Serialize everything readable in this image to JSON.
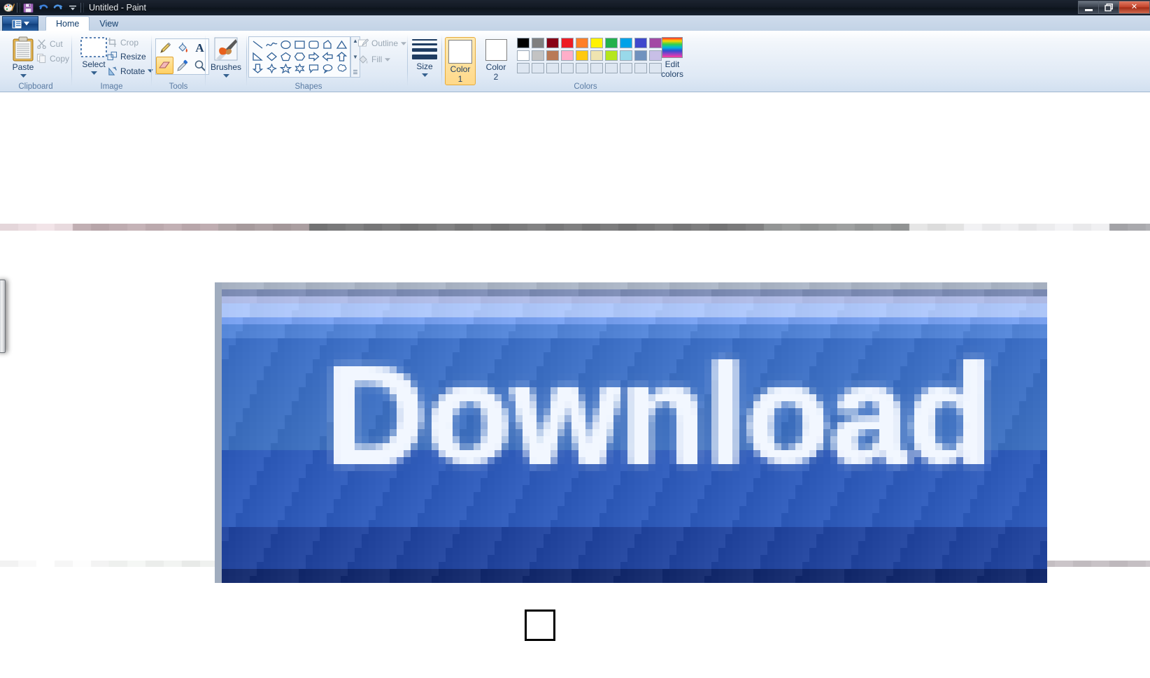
{
  "window": {
    "title": "Untitled - Paint",
    "quick_access": [
      {
        "name": "paint-app-icon",
        "glyph": "🎨"
      },
      {
        "name": "save-icon",
        "glyph": "💾"
      },
      {
        "name": "undo-icon",
        "glyph": "↶"
      },
      {
        "name": "redo-icon",
        "glyph": "↷"
      },
      {
        "name": "customize-qat-icon",
        "glyph": "▾"
      }
    ],
    "controls": [
      {
        "name": "minimize-button",
        "glyph": "–"
      },
      {
        "name": "maximize-button",
        "glyph": "❐"
      },
      {
        "name": "close-button",
        "glyph": "✕"
      }
    ]
  },
  "tabs": {
    "app_button_label": "",
    "items": [
      {
        "label": "Home",
        "active": true
      },
      {
        "label": "View",
        "active": false
      }
    ]
  },
  "ribbon": {
    "groups": [
      {
        "name": "clipboard",
        "label": "Clipboard",
        "big_button": {
          "label": "Paste",
          "icon": "clipboard-icon",
          "has_caret": true
        },
        "small_buttons": [
          {
            "label": "Cut",
            "icon": "scissors-icon",
            "enabled": false
          },
          {
            "label": "Copy",
            "icon": "copy-icon",
            "enabled": false
          }
        ]
      },
      {
        "name": "image",
        "label": "Image",
        "big_button": {
          "label": "Select",
          "icon": "selection-rect-icon",
          "has_caret": true
        },
        "small_buttons": [
          {
            "label": "Crop",
            "icon": "crop-icon",
            "enabled": false
          },
          {
            "label": "Resize",
            "icon": "resize-icon",
            "enabled": true
          },
          {
            "label": "Rotate",
            "icon": "rotate-icon",
            "enabled": true,
            "has_caret": true
          }
        ]
      },
      {
        "name": "tools",
        "label": "Tools",
        "tools": [
          {
            "name": "pencil-tool",
            "selected": false
          },
          {
            "name": "fill-with-color-tool",
            "selected": false
          },
          {
            "name": "text-tool",
            "selected": false
          },
          {
            "name": "eraser-tool",
            "selected": true
          },
          {
            "name": "color-picker-tool",
            "selected": false
          },
          {
            "name": "magnifier-tool",
            "selected": false
          }
        ]
      },
      {
        "name": "brushes",
        "label": "",
        "big_button": {
          "label": "Brushes",
          "icon": "brush-icon",
          "has_caret": true
        }
      },
      {
        "name": "shapes",
        "label": "Shapes",
        "items": [
          "line-shape",
          "curve-shape",
          "oval-shape",
          "rectangle-shape",
          "rounded-rectangle-shape",
          "polygon-shape",
          "triangle-shape",
          "right-triangle-shape",
          "diamond-shape",
          "pentagon-shape",
          "hexagon-shape",
          "right-arrow-shape",
          "left-arrow-shape",
          "up-arrow-shape",
          "down-arrow-shape",
          "four-point-star-shape",
          "five-point-star-shape",
          "six-point-star-shape",
          "rounded-callout-shape",
          "oval-callout-shape",
          "cloud-callout-shape"
        ],
        "scroll": [
          "▲",
          "▼",
          "≡"
        ],
        "outline": {
          "label": "Outline",
          "enabled": false,
          "has_caret": true
        },
        "fill": {
          "label": "Fill",
          "enabled": false,
          "has_caret": true
        }
      },
      {
        "name": "size",
        "label": "",
        "big_button": {
          "label": "Size",
          "icon": "line-size-icon",
          "has_caret": true
        }
      },
      {
        "name": "colors",
        "label": "Colors",
        "color1": {
          "label_line1": "Color",
          "label_line2": "1",
          "value": "#ffffff",
          "selected": true
        },
        "color2": {
          "label_line1": "Color",
          "label_line2": "2",
          "value": "#ffffff",
          "selected": false
        },
        "palette_row1": [
          "#000000",
          "#7f7f7f",
          "#880015",
          "#ed1c24",
          "#ff7f27",
          "#fff200",
          "#22b14c",
          "#00a2e8",
          "#3f48cc",
          "#a349a4"
        ],
        "palette_row2": [
          "#ffffff",
          "#c3c3c3",
          "#b97a57",
          "#ffaec9",
          "#ffc90e",
          "#efe4b0",
          "#b5e61d",
          "#99d9ea",
          "#7092be",
          "#c8bfe7"
        ],
        "palette_row3": [
          "",
          "",
          "",
          "",
          "",
          "",
          "",
          "",
          "",
          ""
        ],
        "edit_colors": {
          "label_line1": "Edit",
          "label_line2": "colors",
          "icon": "color-wheel-icon"
        }
      }
    ]
  },
  "canvas": {
    "image_name": "download-button-image",
    "image_text": "Download",
    "selection_square_name": "black-outlined-square",
    "scroll_remnant_name": "scrollbar-thumb-remnant"
  },
  "colors": {
    "titlebar_dark": "#131a24",
    "ribbon_bg": "#dfe9f5",
    "tab_active": "#ffffff",
    "accent_blue": "#1d4f8f",
    "selected_tool_gold": "#ffd165",
    "download_button_blue": "#3b6fc4",
    "canvas_white": "#ffffff"
  }
}
